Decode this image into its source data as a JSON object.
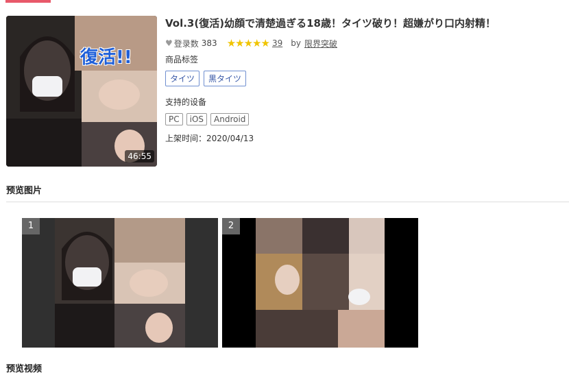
{
  "product": {
    "title": "Vol.3(復活)幼顔で清楚過ぎる18歳！タイツ破り！超嫌がり口内射精！",
    "thumbnail_overlay_text": "復活!!",
    "duration": "46:55",
    "favorites_label": "登录数",
    "favorites_count": "383",
    "stars": "★★★★★",
    "rating_count": "39",
    "by_label": "by",
    "author": "限界突破",
    "tags_label": "商品标签",
    "tags": [
      "タイツ",
      "黒タイツ"
    ],
    "devices_label": "支持的设备",
    "devices": [
      "PC",
      "iOS",
      "Android"
    ],
    "release_label": "上架时间：",
    "release_date": "2020/04/13"
  },
  "sections": {
    "preview_images": "预览图片",
    "preview_video": "预览视频"
  },
  "previews": [
    {
      "number": "1"
    },
    {
      "number": "2"
    }
  ],
  "colors": {
    "accent": "#e8596a",
    "tag_border": "#6f8fd0",
    "star": "#f0c400"
  }
}
